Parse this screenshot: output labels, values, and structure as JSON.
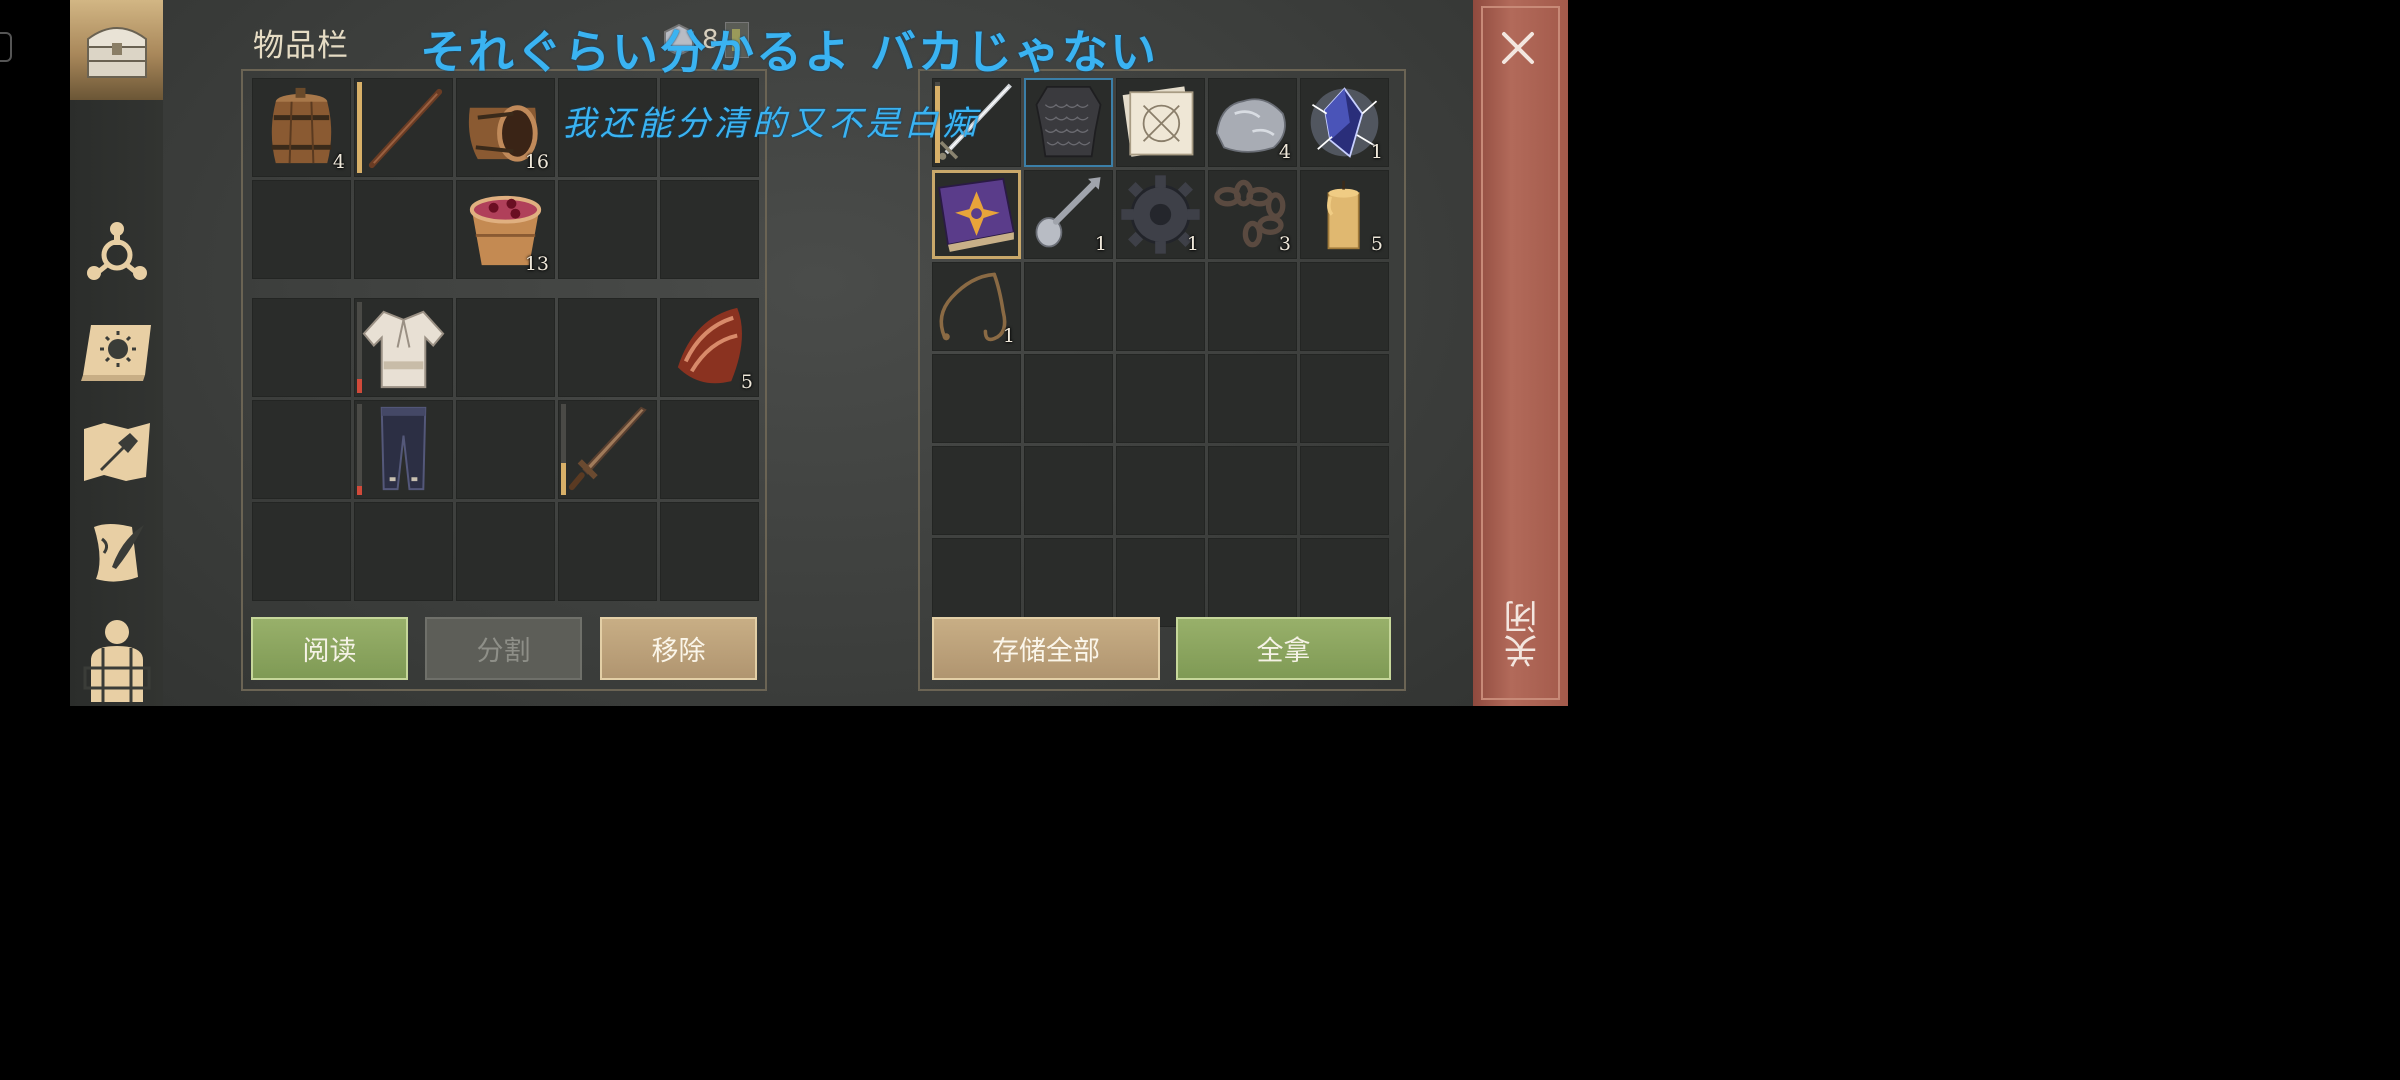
{
  "sidebar": {
    "items": [
      {
        "name": "storage-chest",
        "icon": "chest-icon",
        "active": true
      },
      {
        "name": "skills",
        "icon": "skill-tree-icon"
      },
      {
        "name": "recipes-book",
        "icon": "sun-book-icon"
      },
      {
        "name": "crafting",
        "icon": "hammer-map-icon"
      },
      {
        "name": "quests",
        "icon": "scroll-quill-icon"
      },
      {
        "name": "character",
        "icon": "character-backpack-icon"
      }
    ]
  },
  "inventory": {
    "title": "物品栏",
    "weight": "8",
    "top_rows": [
      [
        {
          "item": "barrel",
          "qty": "4"
        },
        {
          "item": "wooden-stick",
          "dur": 1.0
        },
        {
          "item": "open-barrel",
          "qty": "16"
        },
        {},
        {}
      ],
      [
        {},
        {},
        {
          "item": "berry-bucket",
          "qty": "13"
        },
        {},
        {}
      ]
    ],
    "equip_rows": [
      [
        {},
        {
          "item": "shirt",
          "dur": 0.15
        },
        {},
        {},
        {
          "item": "bacon",
          "qty": "5"
        }
      ],
      [
        {},
        {
          "item": "pants",
          "dur": 0.1
        },
        {},
        {
          "item": "sword",
          "dur": 0.35
        },
        {}
      ],
      [
        {},
        {},
        {},
        {},
        {}
      ]
    ],
    "buttons": {
      "read": "阅读",
      "split": "分割",
      "remove": "移除"
    }
  },
  "storage": {
    "rows": [
      [
        {
          "item": "long-sword",
          "dur": 0.95
        },
        {
          "item": "chainmail",
          "selected": "blue"
        },
        {
          "item": "blueprint"
        },
        {
          "item": "stone",
          "qty": "4"
        },
        {
          "item": "crystal",
          "qty": "1"
        }
      ],
      [
        {
          "item": "purple-book",
          "selected": "gold"
        },
        {
          "item": "spoon",
          "qty": "1"
        },
        {
          "item": "gear",
          "qty": "1"
        },
        {
          "item": "chain",
          "qty": "3"
        },
        {
          "item": "candle",
          "qty": "5"
        }
      ],
      [
        {
          "item": "rope",
          "qty": "1"
        },
        {},
        {},
        {},
        {}
      ],
      [
        {},
        {},
        {},
        {},
        {}
      ],
      [
        {},
        {},
        {},
        {},
        {}
      ],
      [
        {},
        {},
        {},
        {},
        {}
      ]
    ],
    "buttons": {
      "store_all": "存储全部",
      "take_all": "全拿"
    }
  },
  "subtitles": {
    "japanese": "それぐらい分かるよ バカじゃない",
    "chinese": "我还能分清的又不是白痴"
  },
  "close": {
    "label": "关闭"
  },
  "colors": {
    "accent_green": "#8aa45e",
    "accent_tan": "#bca27a",
    "close_red": "#a85c4c",
    "subtitle": "#3ab3f2"
  }
}
